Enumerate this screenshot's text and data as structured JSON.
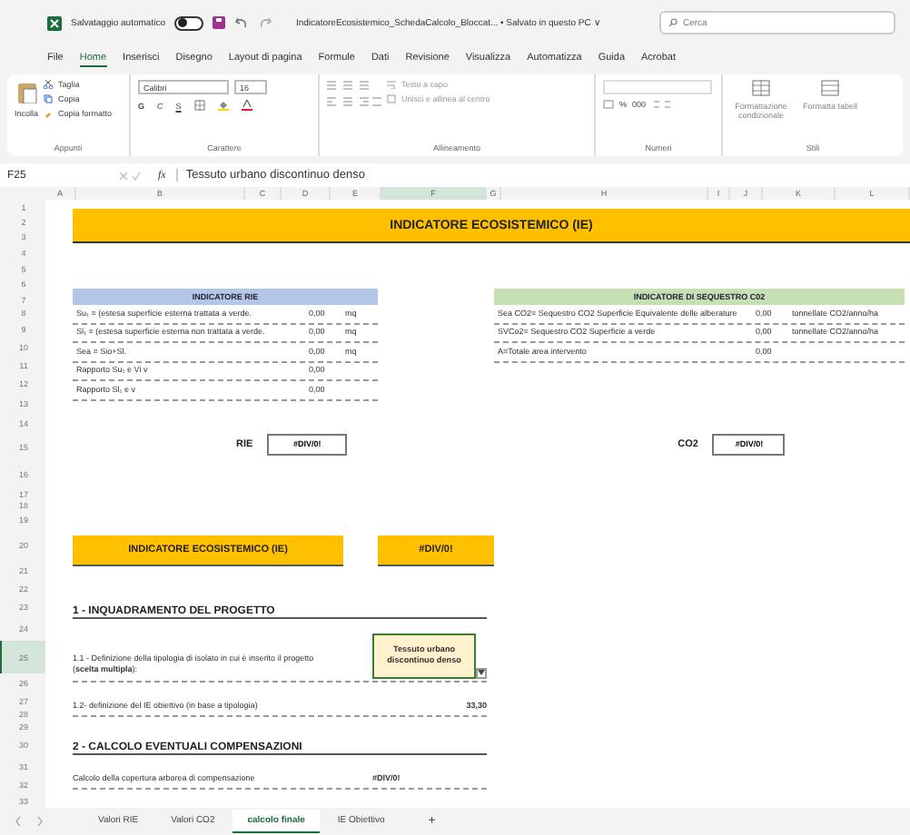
{
  "title_bar": {
    "autosave_label": "Salvataggio automatico",
    "autosave_on": false,
    "file_name": "IndicatoreEcosistemico_SchedaCalcolo_Bloccat... • Salvato in questo PC ∨",
    "search_placeholder": "Cerca"
  },
  "menu": [
    {
      "label": "File",
      "selected": false
    },
    {
      "label": "Home",
      "selected": true
    },
    {
      "label": "Inserisci",
      "selected": false
    },
    {
      "label": "Disegno",
      "selected": false
    },
    {
      "label": "Layout di pagina",
      "selected": false
    },
    {
      "label": "Formule",
      "selected": false
    },
    {
      "label": "Dati",
      "selected": false
    },
    {
      "label": "Revisione",
      "selected": false
    },
    {
      "label": "Visualizza",
      "selected": false
    },
    {
      "label": "Automatizza",
      "selected": false
    },
    {
      "label": "Guida",
      "selected": false
    },
    {
      "label": "Acrobat",
      "selected": false
    }
  ],
  "ribbon": {
    "paste": "Incolla",
    "cut": "Taglia",
    "copy": "Copia",
    "format_painter": "Copia formatto",
    "font": "Calibri",
    "font_size": "16",
    "bold": "G",
    "italic": "C",
    "underline": "S",
    "wrap_text": "Testo a capo",
    "merge": "Unisci e allinea al centro",
    "percent": "%",
    "thousands": "000",
    "conditional": "Formattazione condizionale",
    "format_table": "Formatta tabell",
    "groups": [
      "Appunti",
      "Carattere",
      "Allineamento",
      "Numeri",
      "Stili"
    ]
  },
  "formula_bar": {
    "cell": "F25",
    "fx_label": "fx",
    "formula": "Tessuto urbano discontinuo denso"
  },
  "columns": [
    {
      "label": "A",
      "selected": false
    },
    {
      "label": "B",
      "selected": false
    },
    {
      "label": "C",
      "selected": false
    },
    {
      "label": "D",
      "selected": false
    },
    {
      "label": "E",
      "selected": false
    },
    {
      "label": "F",
      "selected": true
    },
    {
      "label": "G",
      "selected": false
    },
    {
      "label": "H",
      "selected": false
    },
    {
      "label": "I",
      "selected": false
    },
    {
      "label": "J",
      "selected": false
    },
    {
      "label": "K",
      "selected": false
    },
    {
      "label": "L",
      "selected": false
    }
  ],
  "row_numbers": [
    {
      "label": "1",
      "selected": false
    },
    {
      "label": "2",
      "selected": false
    },
    {
      "label": "3",
      "selected": false
    },
    {
      "label": "4",
      "selected": false
    },
    {
      "label": "5",
      "selected": false
    },
    {
      "label": "6",
      "selected": false
    },
    {
      "label": "7",
      "selected": false
    },
    {
      "label": "8",
      "selected": false
    },
    {
      "label": "9",
      "selected": false
    },
    {
      "label": "10",
      "selected": false
    },
    {
      "label": "11",
      "selected": false
    },
    {
      "label": "12",
      "selected": false
    },
    {
      "label": "13",
      "selected": false
    },
    {
      "label": "14",
      "selected": false
    },
    {
      "label": "15",
      "selected": false
    },
    {
      "label": "16",
      "selected": false
    },
    {
      "label": "17",
      "selected": false
    },
    {
      "label": "18",
      "selected": false
    },
    {
      "label": "19",
      "selected": false
    },
    {
      "label": "20",
      "selected": false
    },
    {
      "label": "21",
      "selected": false
    },
    {
      "label": "22",
      "selected": false
    },
    {
      "label": "23",
      "selected": false
    },
    {
      "label": "24",
      "selected": false
    },
    {
      "label": "25",
      "selected": true
    },
    {
      "label": "26",
      "selected": false
    },
    {
      "label": "27",
      "selected": false
    },
    {
      "label": "28",
      "selected": false
    },
    {
      "label": "29",
      "selected": false
    },
    {
      "label": "30",
      "selected": false
    },
    {
      "label": "31",
      "selected": false
    },
    {
      "label": "32",
      "selected": false
    },
    {
      "label": "33",
      "selected": false
    }
  ],
  "sheet": {
    "banner": "INDICATORE ECOSISTEMICO (IE)",
    "rie_table": {
      "title": "INDICATORE RIE",
      "rows": [
        {
          "label": "Su₁ = (estesa superficie esterna trattata a verde.",
          "value": "0,00",
          "unit": "mq"
        },
        {
          "label": "Sl₁ = (estesa superficie esterna non trattata a verde.",
          "value": "0,00",
          "unit": "mq"
        },
        {
          "label": "Sea = Sio+Sl.",
          "value": "0,00",
          "unit": "mq"
        },
        {
          "label": "Rapporto Su₁ e Vi v",
          "value": "0,00"
        },
        {
          "label": "Rapporto Sl₁ e v",
          "value": "0,00"
        }
      ]
    },
    "co2_table": {
      "title": "INDICATORE DI SEQUESTRO C02",
      "rows": [
        {
          "label": "Sea CO2= Sequestro CO2 Superficie Equivalente delle alberature",
          "value": "0,00",
          "unit": "tonnellate CO2/anno/ha"
        },
        {
          "label": "SVCo2= Sequestro CO2 Superficie a verde",
          "value": "0,00",
          "unit": "tonnellate CO2/anno/ha"
        },
        {
          "label": "A=Totale area intervento",
          "value": "0,00"
        }
      ]
    },
    "rie_result": {
      "label": "RIE",
      "value": "#DIV/0!"
    },
    "co2_result": {
      "label": "CO2",
      "value": "#DIV/0!"
    },
    "ie_summary": {
      "label": "INDICATORE ECOSISTEMICO (IE)",
      "value": "#DIV/0!"
    },
    "section_1": {
      "title": "1 - INQUADRAMENTO DEL PROGETTO",
      "choice": {
        "label": "1.1 - Definizione della tipologia di isolato in cui è inserito il progetto (**scelta multipla**):",
        "value": "Tessuto urbano discontinuo denso"
      },
      "target": {
        "label": "1.2- definizione del IE obiettivo  (in base a tipologia)",
        "value": "33,30"
      }
    },
    "section_2": {
      "title": "2 - CALCOLO EVENTUALI COMPENSAZIONI",
      "row": {
        "label": "Calcolo della copertura arborea di compensazione",
        "value": "#DIV/0!"
      }
    }
  },
  "sheet_tabs": [
    {
      "label": "Valori RIE",
      "selected": false
    },
    {
      "label": "Valori CO2",
      "selected": false
    },
    {
      "label": "calcolo finale",
      "selected": true
    },
    {
      "label": "IE Obiettivo",
      "selected": false
    }
  ],
  "add_sheet": "+"
}
